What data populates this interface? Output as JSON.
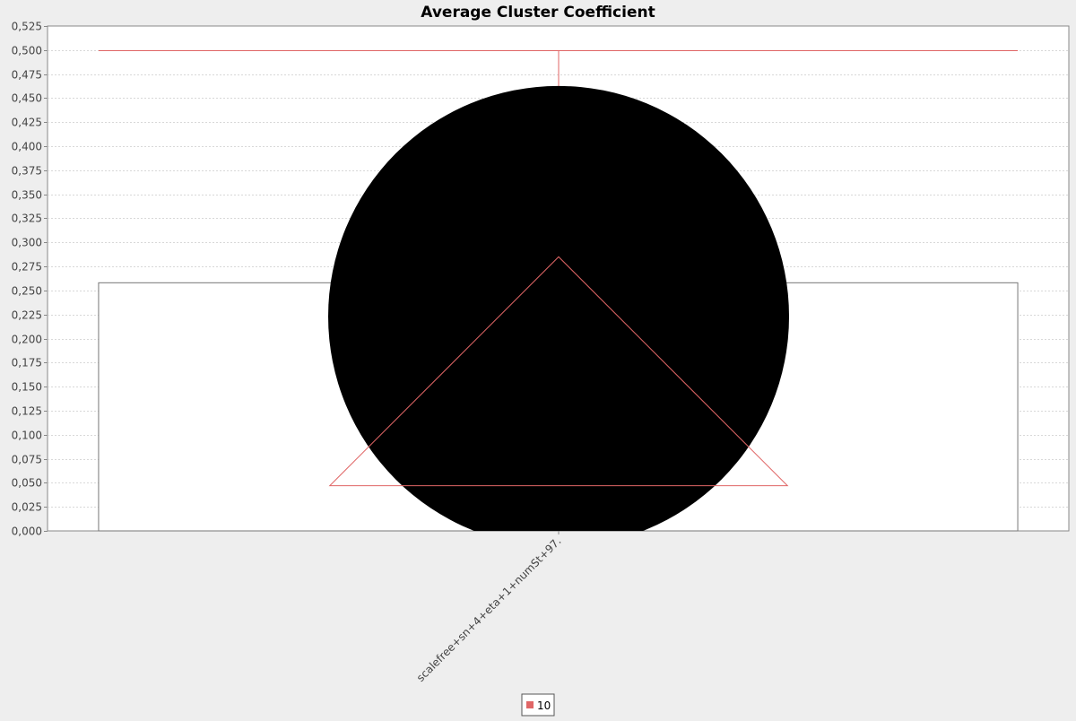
{
  "chart_data": {
    "type": "boxplot",
    "title": "Average Cluster Coefficient",
    "xlabel": "",
    "ylabel": "",
    "ylim": [
      0,
      0.525
    ],
    "ytick_step": 0.025,
    "ytick_decimals": 3,
    "decimal_separator": ",",
    "grid": true,
    "legend_position": "bottom",
    "categories": [
      "scalefree+sn+4+eta+1+numSt+97."
    ],
    "series": [
      {
        "name": "10",
        "color": "#e06666",
        "boxes": [
          {
            "category": "scalefree+sn+4+eta+1+numSt+97.",
            "box_low": 0.0,
            "box_high": 0.258,
            "whisker_high": 0.5,
            "mean": 0.285,
            "marker_center": 0.223,
            "triangle_base": 0.047
          }
        ]
      }
    ]
  }
}
